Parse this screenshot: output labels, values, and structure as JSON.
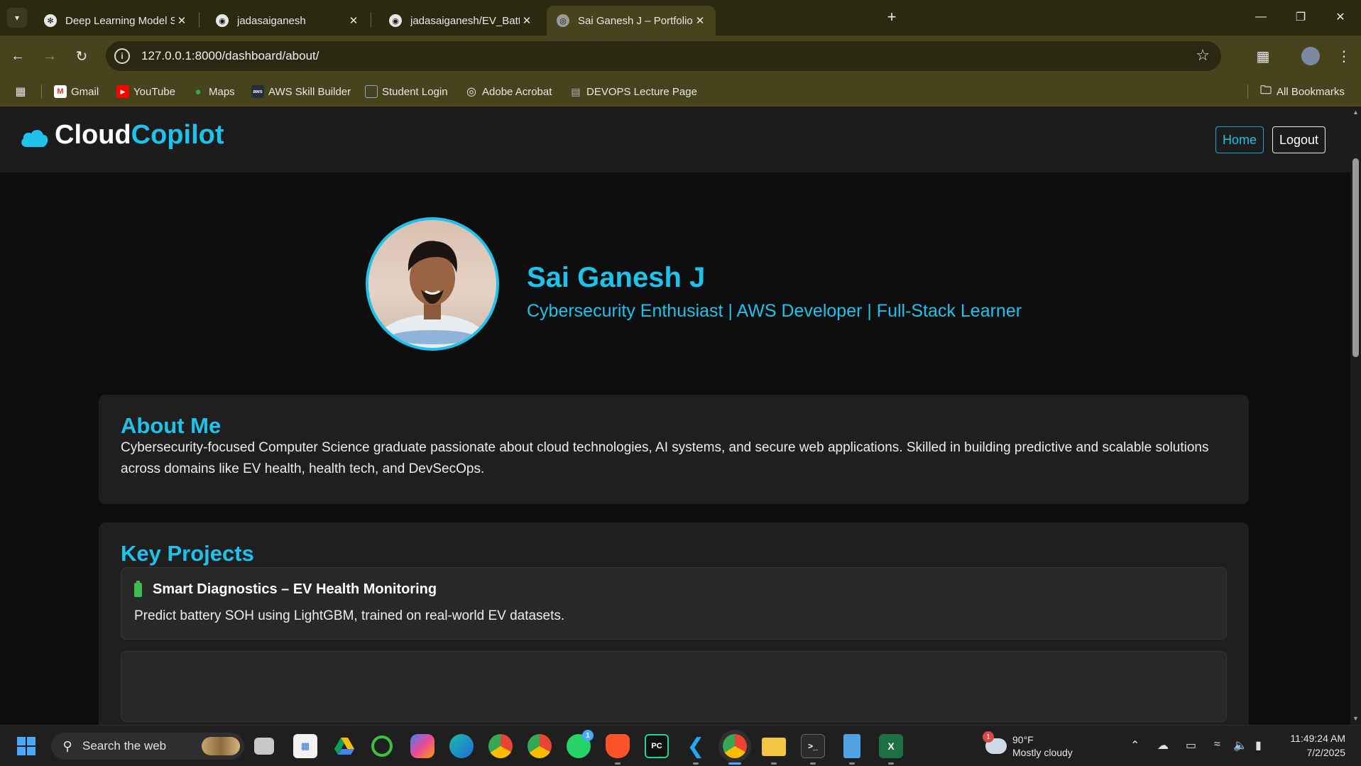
{
  "browser": {
    "tabs": [
      {
        "title": "Deep Learning Model Summary",
        "icon": "openai-icon"
      },
      {
        "title": "jadasaiganesh",
        "icon": "github-icon"
      },
      {
        "title": "jadasaiganesh/EV_Battery_SOH",
        "icon": "github-icon"
      },
      {
        "title": "Sai Ganesh J – Portfolio | Cloud",
        "icon": "globe-icon",
        "active": true
      }
    ],
    "url": "127.0.0.1:8000/dashboard/about/",
    "bookmarks": [
      {
        "label": "Gmail",
        "icon": "gmail-icon"
      },
      {
        "label": "YouTube",
        "icon": "youtube-icon"
      },
      {
        "label": "Maps",
        "icon": "maps-icon"
      },
      {
        "label": "AWS Skill Builder",
        "icon": "aws-icon"
      },
      {
        "label": "Student Login",
        "icon": "student-login-icon"
      },
      {
        "label": "Adobe Acrobat",
        "icon": "globe-icon"
      },
      {
        "label": "DEVOPS Lecture Page",
        "icon": "book-icon"
      }
    ],
    "all_bookmarks": "All Bookmarks"
  },
  "site": {
    "logo": {
      "part1": "Cloud",
      "part2": "Copilot"
    },
    "nav": {
      "home": "Home",
      "logout": "Logout"
    },
    "profile": {
      "name": "Sai Ganesh J",
      "tagline": "Cybersecurity Enthusiast | AWS Developer | Full-Stack Learner"
    },
    "about": {
      "heading": "About Me",
      "text": "Cybersecurity-focused Computer Science graduate passionate about cloud technologies, AI systems, and secure web applications. Skilled in building predictive and scalable solutions across domains like EV health, health tech, and DevSecOps."
    },
    "projects": {
      "heading": "Key Projects",
      "items": [
        {
          "title": "Smart Diagnostics – EV Health Monitoring",
          "description": "Predict battery SOH using LightGBM, trained on real-world EV datasets.",
          "icon": "battery-icon"
        }
      ]
    }
  },
  "taskbar": {
    "search_placeholder": "Search the web",
    "weather": {
      "temp": "90°F",
      "condition": "Mostly cloudy",
      "badge": "1"
    },
    "whatsapp_badge": "1",
    "time": "11:49:24 AM",
    "date": "7/2/2025"
  },
  "colors": {
    "accent": "#1ec3ec",
    "card_bg": "#1f1f1f",
    "page_bg": "#0e0e0e"
  }
}
